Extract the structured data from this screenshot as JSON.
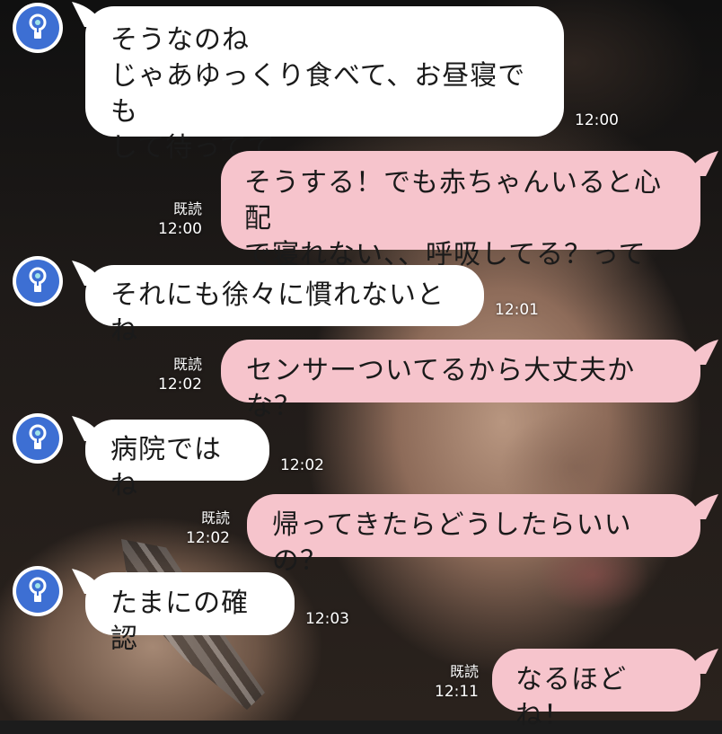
{
  "messages": [
    {
      "side": "in",
      "text": "そうなのね\nじゃあゆっくり食べて、お昼寝でも\nして待ってて",
      "time": "12:00"
    },
    {
      "side": "out",
      "text": "そうする！でも赤ちゃんいると心配\nで寝れない、、呼吸してる？って",
      "time": "12:00",
      "read": "既読"
    },
    {
      "side": "in",
      "text": "それにも徐々に慣れないとね",
      "time": "12:01"
    },
    {
      "side": "out",
      "text": "センサーついてるから大丈夫かな？",
      "time": "12:02",
      "read": "既読"
    },
    {
      "side": "in",
      "text": "病院ではね",
      "time": "12:02"
    },
    {
      "side": "out",
      "text": "帰ってきたらどうしたらいいの？",
      "time": "12:02",
      "read": "既読"
    },
    {
      "side": "in",
      "text": "たまにの確認",
      "time": "12:03"
    },
    {
      "side": "out",
      "text": "なるほどね！",
      "time": "12:11",
      "read": "既読"
    }
  ],
  "contact": {
    "avatar_icon": "lightbulb-icon"
  },
  "colors": {
    "incoming": "#ffffff",
    "outgoing": "#f6c4cc",
    "avatar": "#3d6fd3"
  }
}
